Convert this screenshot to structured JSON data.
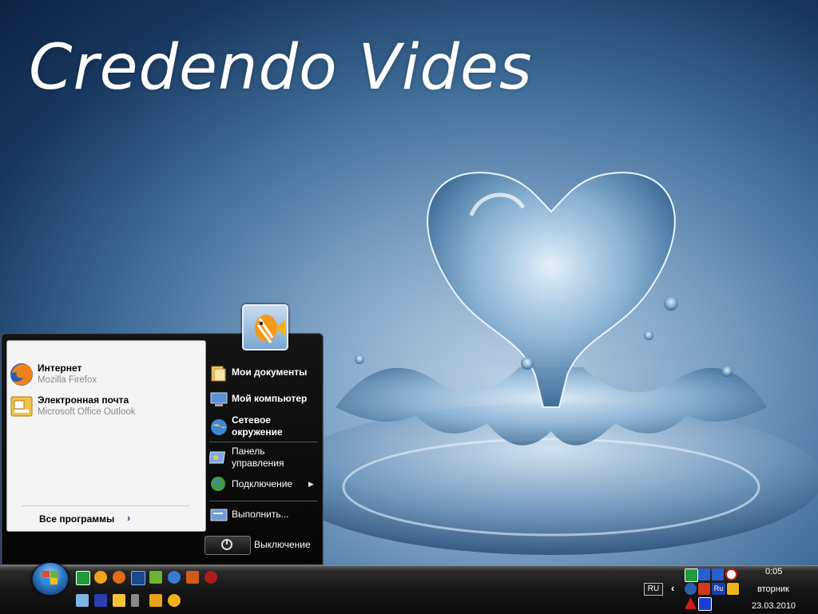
{
  "wallpaper": {
    "title": "Credendo Vides"
  },
  "start_menu": {
    "pinned": [
      {
        "title": "Интернет",
        "subtitle": "Mozilla Firefox",
        "icon": "firefox-icon"
      },
      {
        "title": "Электронная почта",
        "subtitle": "Microsoft Office Outlook",
        "icon": "outlook-icon"
      }
    ],
    "all_programs": "Все программы",
    "right": {
      "my_documents": "Мои документы",
      "my_computer": "Мой компьютер",
      "network": "Сетевое окружение",
      "control_panel": "Панель управления",
      "connect": "Подключение",
      "run": "Выполнить...",
      "shutdown": "Выключение"
    }
  },
  "taskbar": {
    "language": "RU",
    "tray_ru_label": "Ru",
    "clock": {
      "time": "0:05",
      "day": "вторник",
      "date": "23.03.2010"
    }
  },
  "colors": {
    "accent": "#2f7bc4",
    "menu_bg": "#0b0b0b"
  }
}
